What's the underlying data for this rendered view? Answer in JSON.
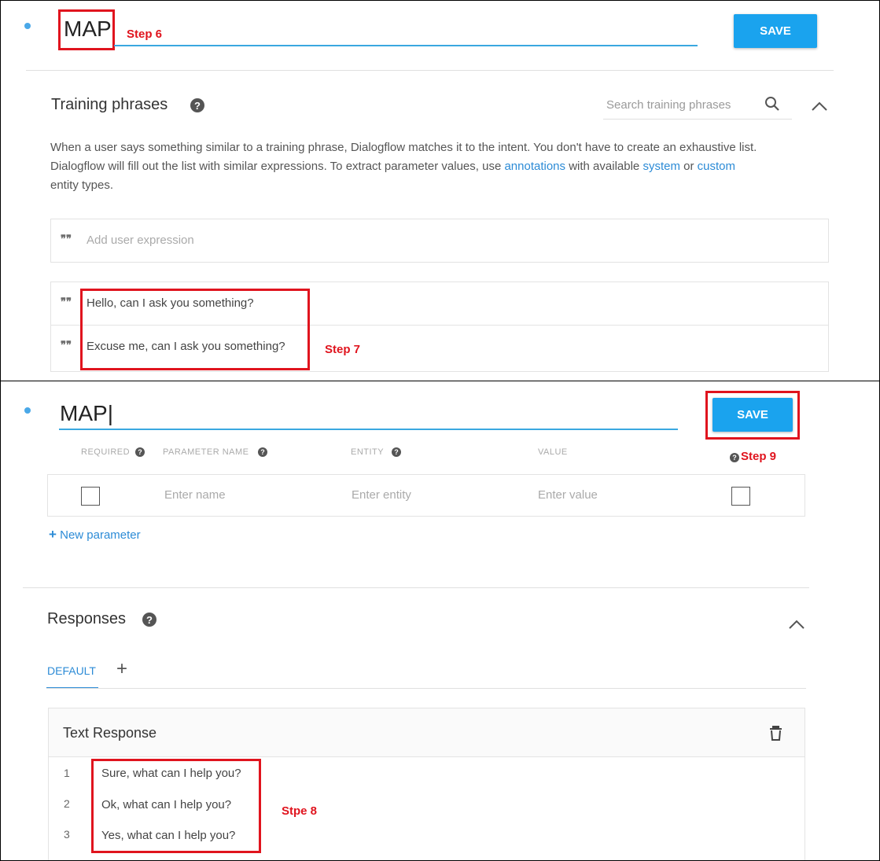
{
  "panel1": {
    "title": "MAP",
    "save_label": "SAVE",
    "step_title": "Step 6",
    "training": {
      "title": "Training phrases",
      "search_placeholder": "Search training phrases",
      "desc_part1": "When a user says something similar to a training phrase, Dialogflow matches it to the intent. You don't have to create an exhaustive list.",
      "desc_part2": "Dialogflow will fill out the list with similar expressions. To extract parameter values, use",
      "link_annotations": "annotations",
      "desc_part3": "with available",
      "link_system": "system",
      "desc_part4": "or",
      "link_custom": "custom",
      "desc_part5": "entity types.",
      "add_placeholder": "Add user expression",
      "phrases": [
        "Hello, can I ask you something?",
        "Excuse me, can I ask you something?"
      ],
      "step_label": "Step 7"
    }
  },
  "panel2": {
    "title": "MAP",
    "save_label": "SAVE",
    "step_save": "Step 9",
    "params": {
      "headers": [
        "REQUIRED",
        "PARAMETER NAME",
        "ENTITY",
        "VALUE"
      ],
      "name_placeholder": "Enter name",
      "entity_placeholder": "Enter entity",
      "value_placeholder": "Enter value",
      "new_param": "New parameter"
    },
    "responses": {
      "title": "Responses",
      "tab_default": "DEFAULT",
      "tab_add": "+",
      "card_title": "Text Response",
      "items": [
        {
          "num": "1",
          "text": "Sure, what can I help you?"
        },
        {
          "num": "2",
          "text": "Ok, what can I help you?"
        },
        {
          "num": "3",
          "text": "Yes, what can I help you?"
        }
      ],
      "step_label": "Stpe 8"
    }
  },
  "icons": {
    "help": "help-circle-icon",
    "search": "search-icon",
    "collapse": "chevron-up-icon",
    "quote": "quote-icon",
    "trash": "trash-icon",
    "plus": "plus-icon"
  },
  "colors": {
    "accent": "#1aa3ee",
    "link": "#2c8bd6",
    "annotation": "#e0141e"
  }
}
